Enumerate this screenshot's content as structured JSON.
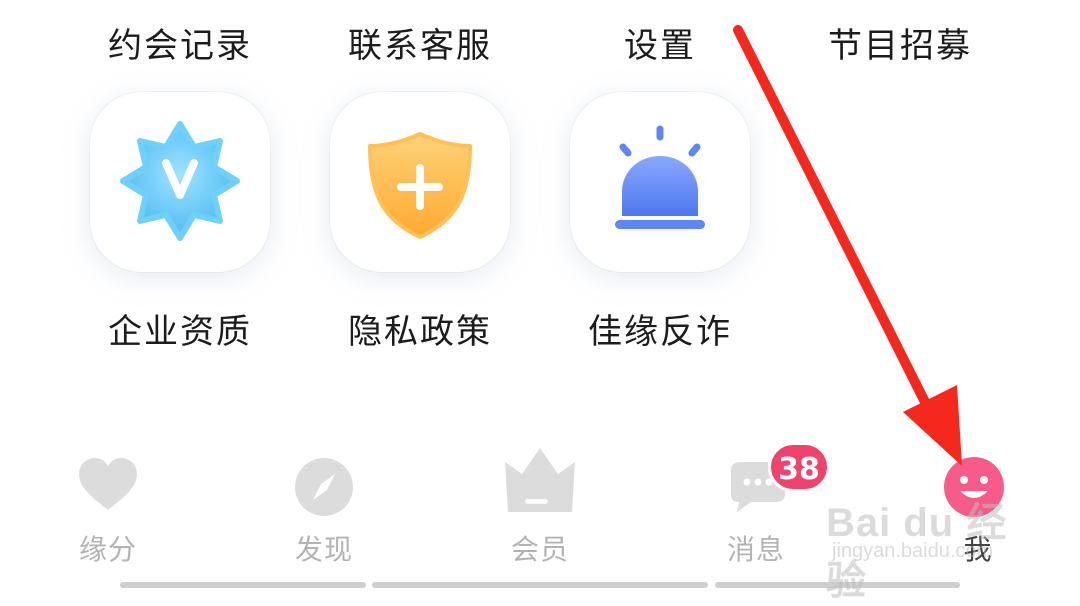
{
  "top_row": [
    {
      "label": "约会记录"
    },
    {
      "label": "联系客服"
    },
    {
      "label": "设置"
    },
    {
      "label": "节目招募"
    }
  ],
  "services": [
    {
      "label": "企业资质",
      "icon": "verified-badge-icon",
      "color": "#5cc8f5"
    },
    {
      "label": "隐私政策",
      "icon": "shield-plus-icon",
      "color": "#ffb53c"
    },
    {
      "label": "佳缘反诈",
      "icon": "alarm-siren-icon",
      "color": "#5d86f6"
    }
  ],
  "tabbar": {
    "items": [
      {
        "label": "缘分",
        "icon": "heart-icon"
      },
      {
        "label": "发现",
        "icon": "compass-icon"
      },
      {
        "label": "会员",
        "icon": "crown-icon"
      },
      {
        "label": "消息",
        "icon": "chat-bubble-icon",
        "badge": "38"
      },
      {
        "label": "我",
        "icon": "smile-face-icon"
      }
    ],
    "active_label_color": "#444444",
    "inactive_color": "#d9d9d9",
    "accent": "#f0426a"
  },
  "annotation": {
    "arrow_color": "#f5281e"
  },
  "watermark": {
    "main": "Bai du 经验",
    "sub": "jingyan.baidu.com"
  }
}
